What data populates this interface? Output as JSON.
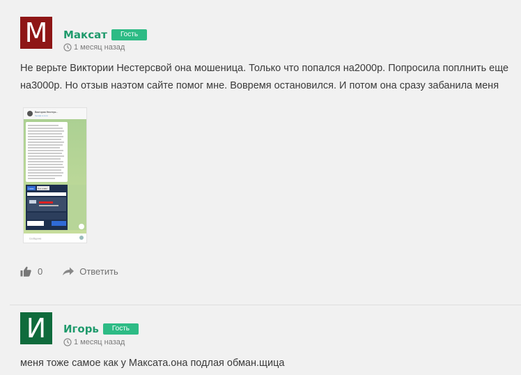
{
  "comments": [
    {
      "avatar_letter": "M",
      "avatar_color": "#8e1616",
      "author": "Максат",
      "badge": "Гость",
      "time": "1 месяц назад",
      "text_line1": "Не верьте Виктории Нестерсвой она мошеница. Только что попался на2000р. Попросила поплнить еще",
      "text_line2": "на3000р. Но отзыв наэтом сайте помог мне. Вовремя остановился. И потом она сразу забанила меня",
      "likes": "0",
      "reply_label": "Ответить",
      "attachment": {
        "header_name": "Виктория Нестерс...",
        "header_status": "был(а) в сети",
        "tab_active": "Ставка",
        "tab_other": "Мои ставки",
        "input_placeholder": "Сообщение"
      }
    },
    {
      "avatar_letter": "И",
      "avatar_color": "#0f6b3c",
      "author": "Игорь",
      "badge": "Гость",
      "time": "1 месяц назад",
      "text_line1": "меня тоже самое как у Максата.она подлая обман.щица"
    }
  ],
  "colors": {
    "accent_green": "#1f9a6c",
    "badge_green": "#2dbb85",
    "background": "#f1f1f1"
  },
  "icons": [
    "clock-icon",
    "thumbs-up-icon",
    "reply-arrow-icon"
  ]
}
